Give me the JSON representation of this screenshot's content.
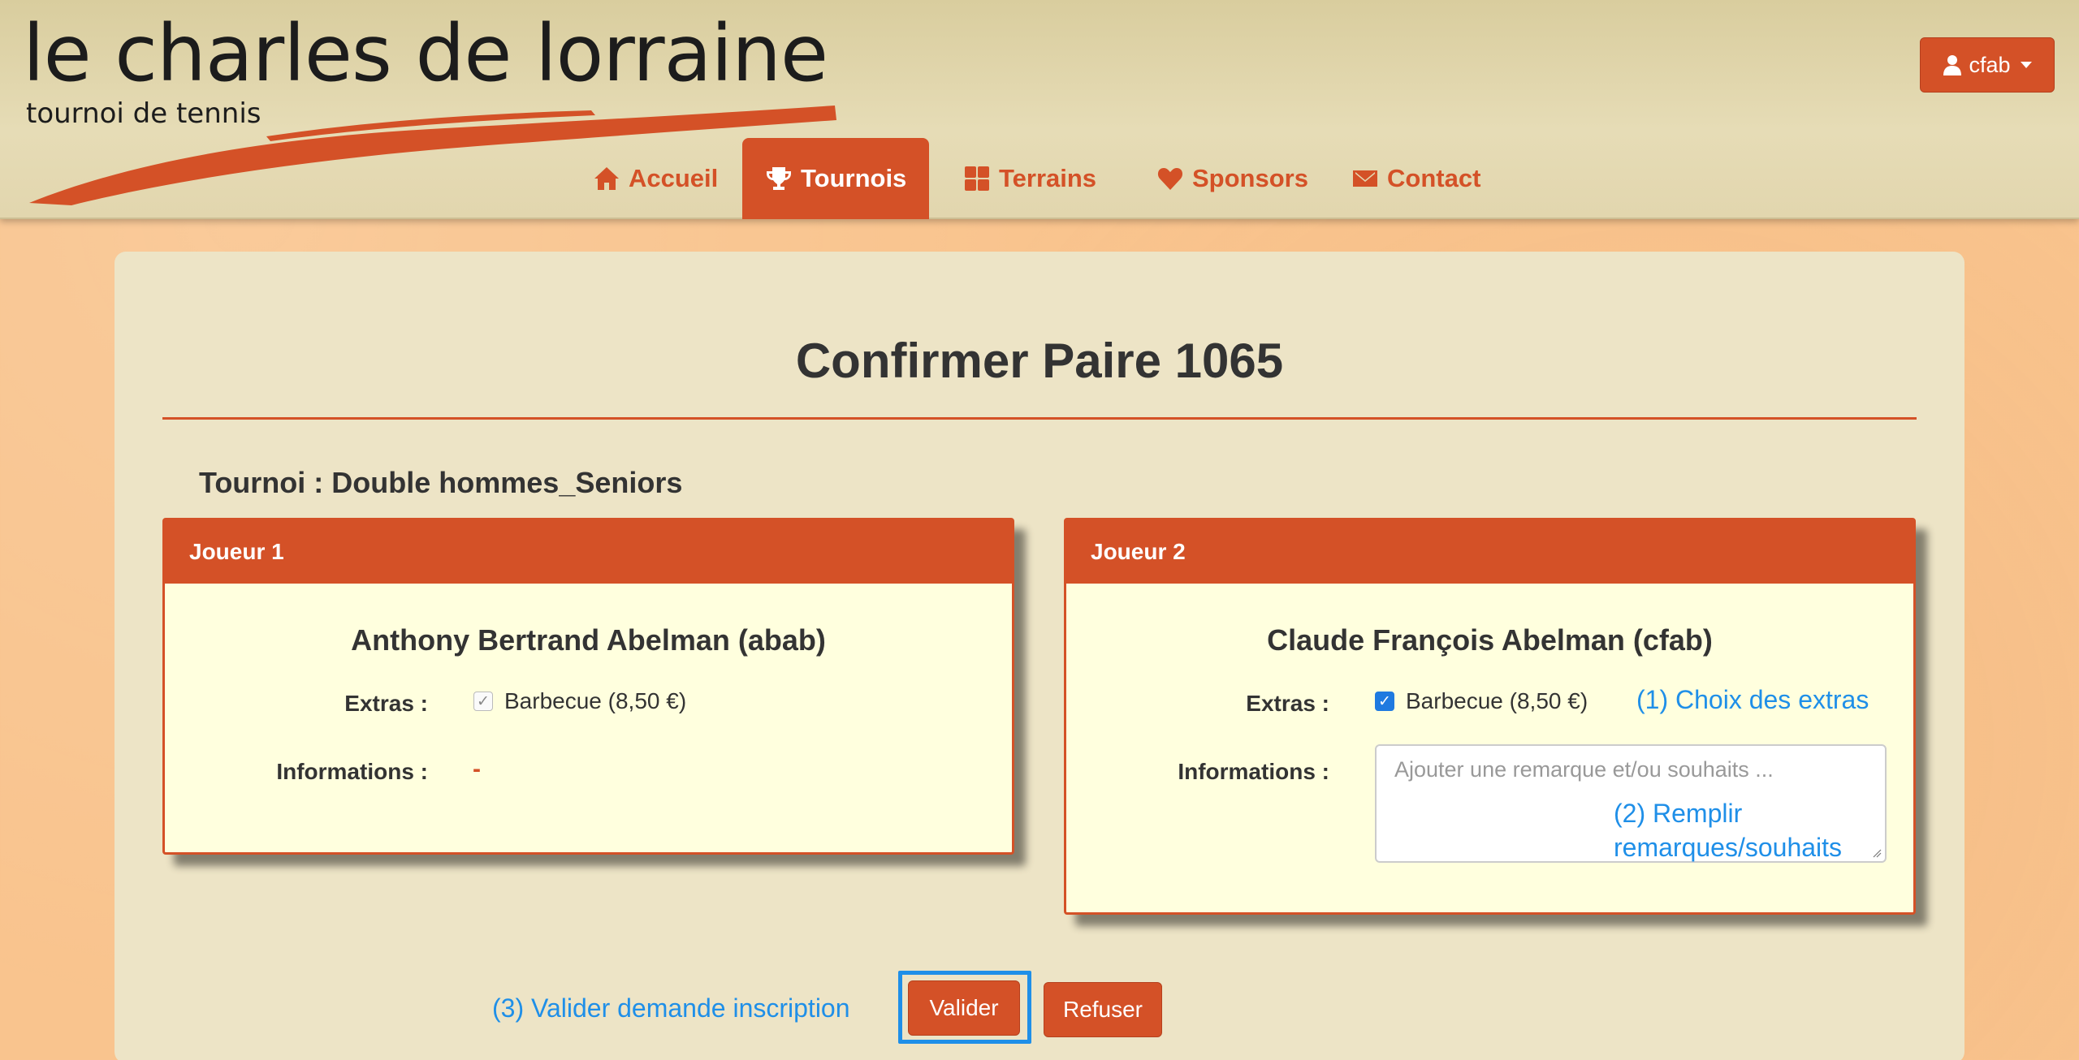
{
  "logo": {
    "title": "le charles de lorraine",
    "subtitle": "tournoi de tennis"
  },
  "user_menu": {
    "label": "cfab"
  },
  "nav": {
    "items": [
      {
        "label": "Accueil",
        "icon": "home-icon"
      },
      {
        "label": "Tournois",
        "icon": "trophy-icon",
        "active": true
      },
      {
        "label": "Terrains",
        "icon": "grid-icon"
      },
      {
        "label": "Sponsors",
        "icon": "heart-icon"
      },
      {
        "label": "Contact",
        "icon": "envelope-icon"
      }
    ]
  },
  "page": {
    "title": "Confirmer Paire 1065",
    "tournament": "Tournoi : Double hommes_Seniors"
  },
  "player1": {
    "header": "Joueur 1",
    "name": "Anthony Bertrand Abelman (abab)",
    "extras_label": "Extras :",
    "extra_item": "Barbecue (8,50 €)",
    "extra_checked": true,
    "info_label": "Informations :",
    "info_value": "-"
  },
  "player2": {
    "header": "Joueur 2",
    "name": "Claude François Abelman (cfab)",
    "extras_label": "Extras :",
    "extra_item": "Barbecue (8,50 €)",
    "extra_checked": true,
    "info_label": "Informations :",
    "info_placeholder": "Ajouter une remarque et/ou souhaits ..."
  },
  "annotations": {
    "step1": "(1) Choix des extras",
    "step2_line1": "(2) Remplir",
    "step2_line2": "remarques/souhaits",
    "step3": "(3) Valider demande inscription"
  },
  "actions": {
    "validate": "Valider",
    "refuse": "Refuser"
  },
  "colors": {
    "accent": "#d45127",
    "annotation": "#1f8fe8",
    "card_bg": "#ffffde",
    "panel_bg": "#ede4c6",
    "page_bg": "#f9c48e"
  }
}
